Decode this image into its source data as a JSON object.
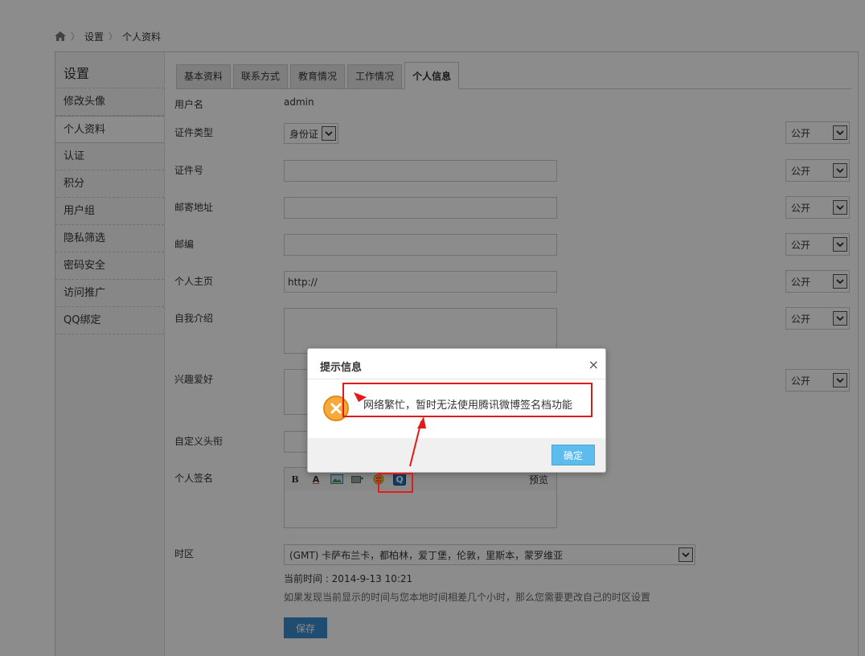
{
  "breadcrumb": {
    "home_icon": "home-icon",
    "items": [
      "设置",
      "个人资料"
    ]
  },
  "sidebar": {
    "title": "设置",
    "items": [
      {
        "label": "修改头像"
      },
      {
        "label": "个人资料"
      },
      {
        "label": "认证"
      },
      {
        "label": "积分"
      },
      {
        "label": "用户组"
      },
      {
        "label": "隐私筛选"
      },
      {
        "label": "密码安全"
      },
      {
        "label": "访问推广"
      },
      {
        "label": "QQ绑定"
      }
    ]
  },
  "tabs": [
    {
      "label": "基本资料"
    },
    {
      "label": "联系方式"
    },
    {
      "label": "教育情况"
    },
    {
      "label": "工作情况"
    },
    {
      "label": "个人信息",
      "active": true
    }
  ],
  "form": {
    "username_label": "用户名",
    "username_value": "admin",
    "id_type_label": "证件类型",
    "id_type_value": "身份证",
    "id_number_label": "证件号",
    "address_label": "邮寄地址",
    "zipcode_label": "邮编",
    "homepage_label": "个人主页",
    "homepage_value": "http://",
    "bio_label": "自我介绍",
    "hobby_label": "兴趣爱好",
    "title_label": "自定义头衔",
    "signature_label": "个人签名",
    "signature_preview": "预览",
    "timezone_label": "时区",
    "timezone_value": "(GMT) 卡萨布兰卡，都柏林，爱丁堡，伦敦，里斯本，蒙罗维亚",
    "current_time": "当前时间 : 2014-9-13 10:21",
    "timezone_hint": "如果发现当前显示的时间与您本地时间相差几个小时，那么您需要更改自己的时区设置",
    "save_label": "保存",
    "privacy_label": "公开"
  },
  "dialog": {
    "title": "提示信息",
    "close": "×",
    "message": "网络繁忙，暂时无法使用腾讯微博签名档功能",
    "ok_label": "确定"
  },
  "colors": {
    "accent": "#3a8ccf",
    "ok_button": "#5cbcee",
    "annotation": "#e21a1a",
    "error_icon": "#f7a93c"
  }
}
